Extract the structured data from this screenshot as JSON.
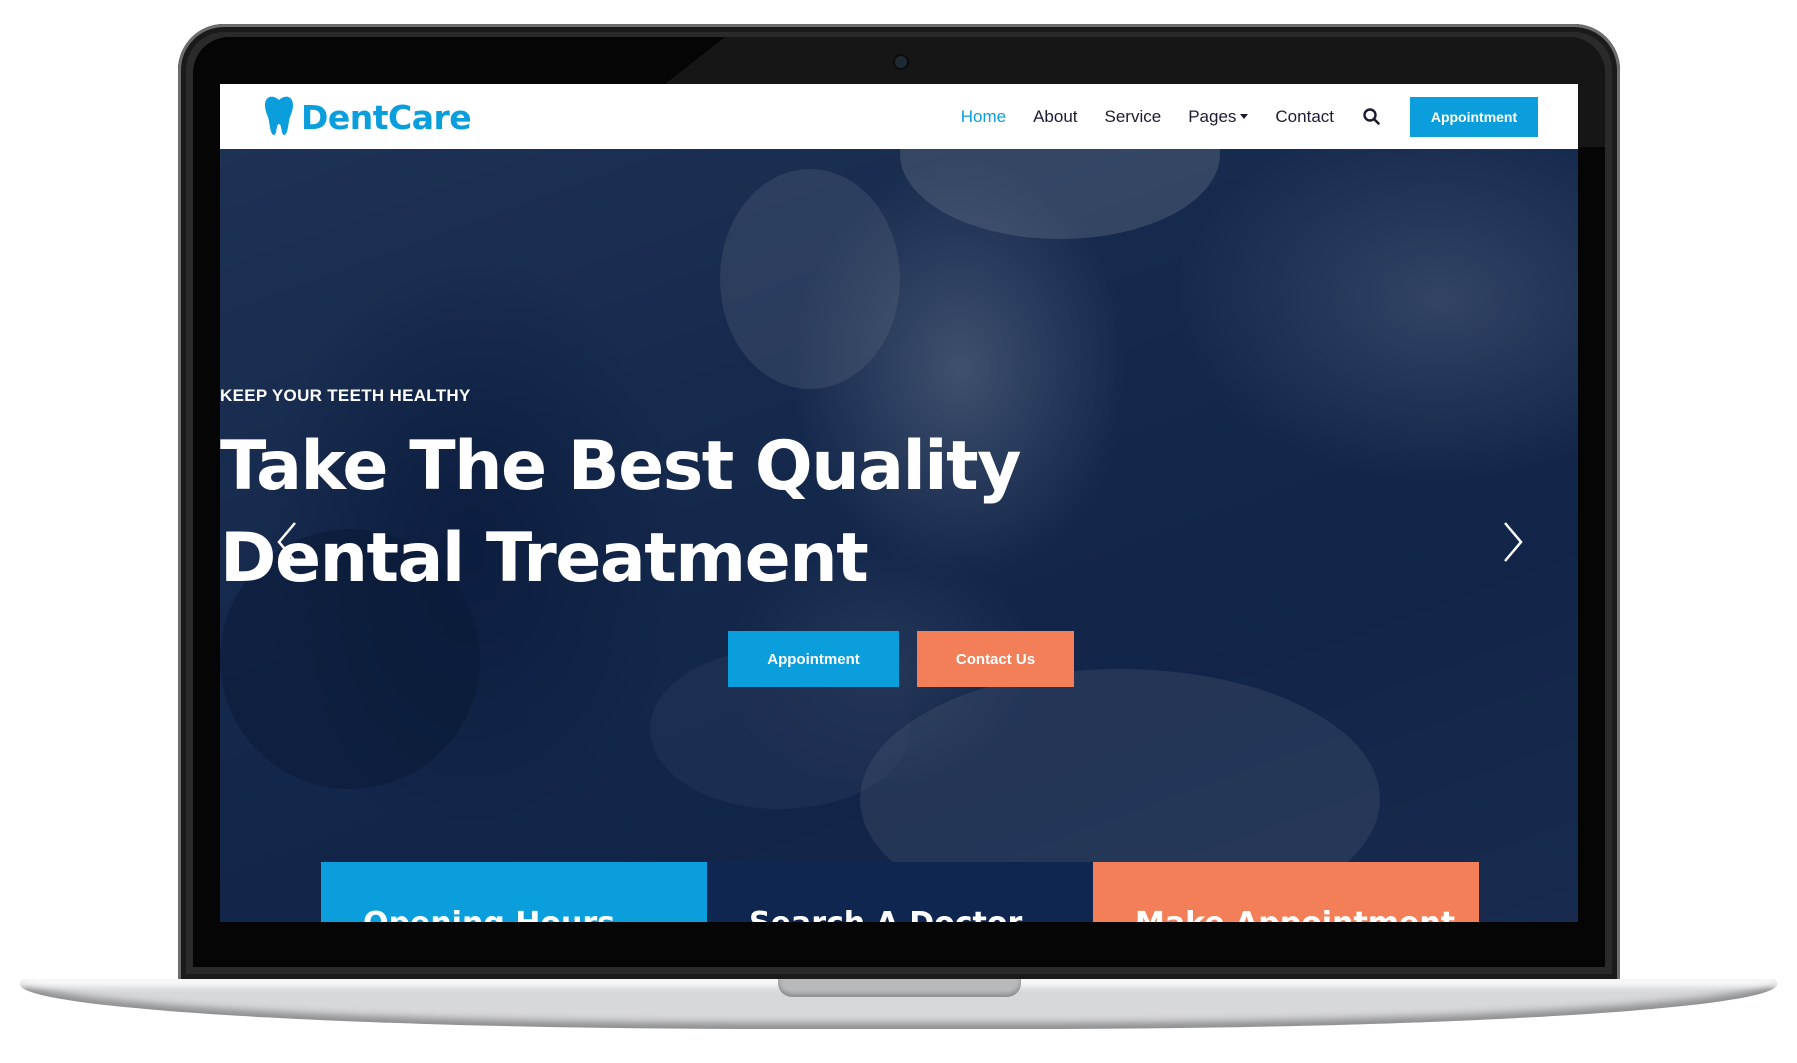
{
  "brand": {
    "name": "DentCare",
    "color": "#0a9fdc",
    "icon": "tooth-icon"
  },
  "nav": {
    "items": [
      {
        "label": "Home",
        "active": true
      },
      {
        "label": "About"
      },
      {
        "label": "Service"
      },
      {
        "label": "Pages",
        "dropdown": true
      },
      {
        "label": "Contact"
      }
    ],
    "search_icon": "search-icon",
    "appointment_label": "Appointment"
  },
  "hero": {
    "kicker": "KEEP YOUR TEETH HEALTHY",
    "title_line1": "Take The Best Quality",
    "title_line2": "Dental Treatment",
    "primary_button": "Appointment",
    "secondary_button": "Contact Us",
    "prev_icon": "chevron-left-icon",
    "next_icon": "chevron-right-icon"
  },
  "cards": [
    {
      "label": "Opening Hours",
      "color": "#0a9fdc"
    },
    {
      "label": "Search A Doctor",
      "color": "#0e2650"
    },
    {
      "label": "Make Appointment",
      "color": "#f27f58"
    }
  ],
  "colors": {
    "primary": "#0a9fdc",
    "secondary": "#f27f58",
    "dark": "#0e2650"
  }
}
